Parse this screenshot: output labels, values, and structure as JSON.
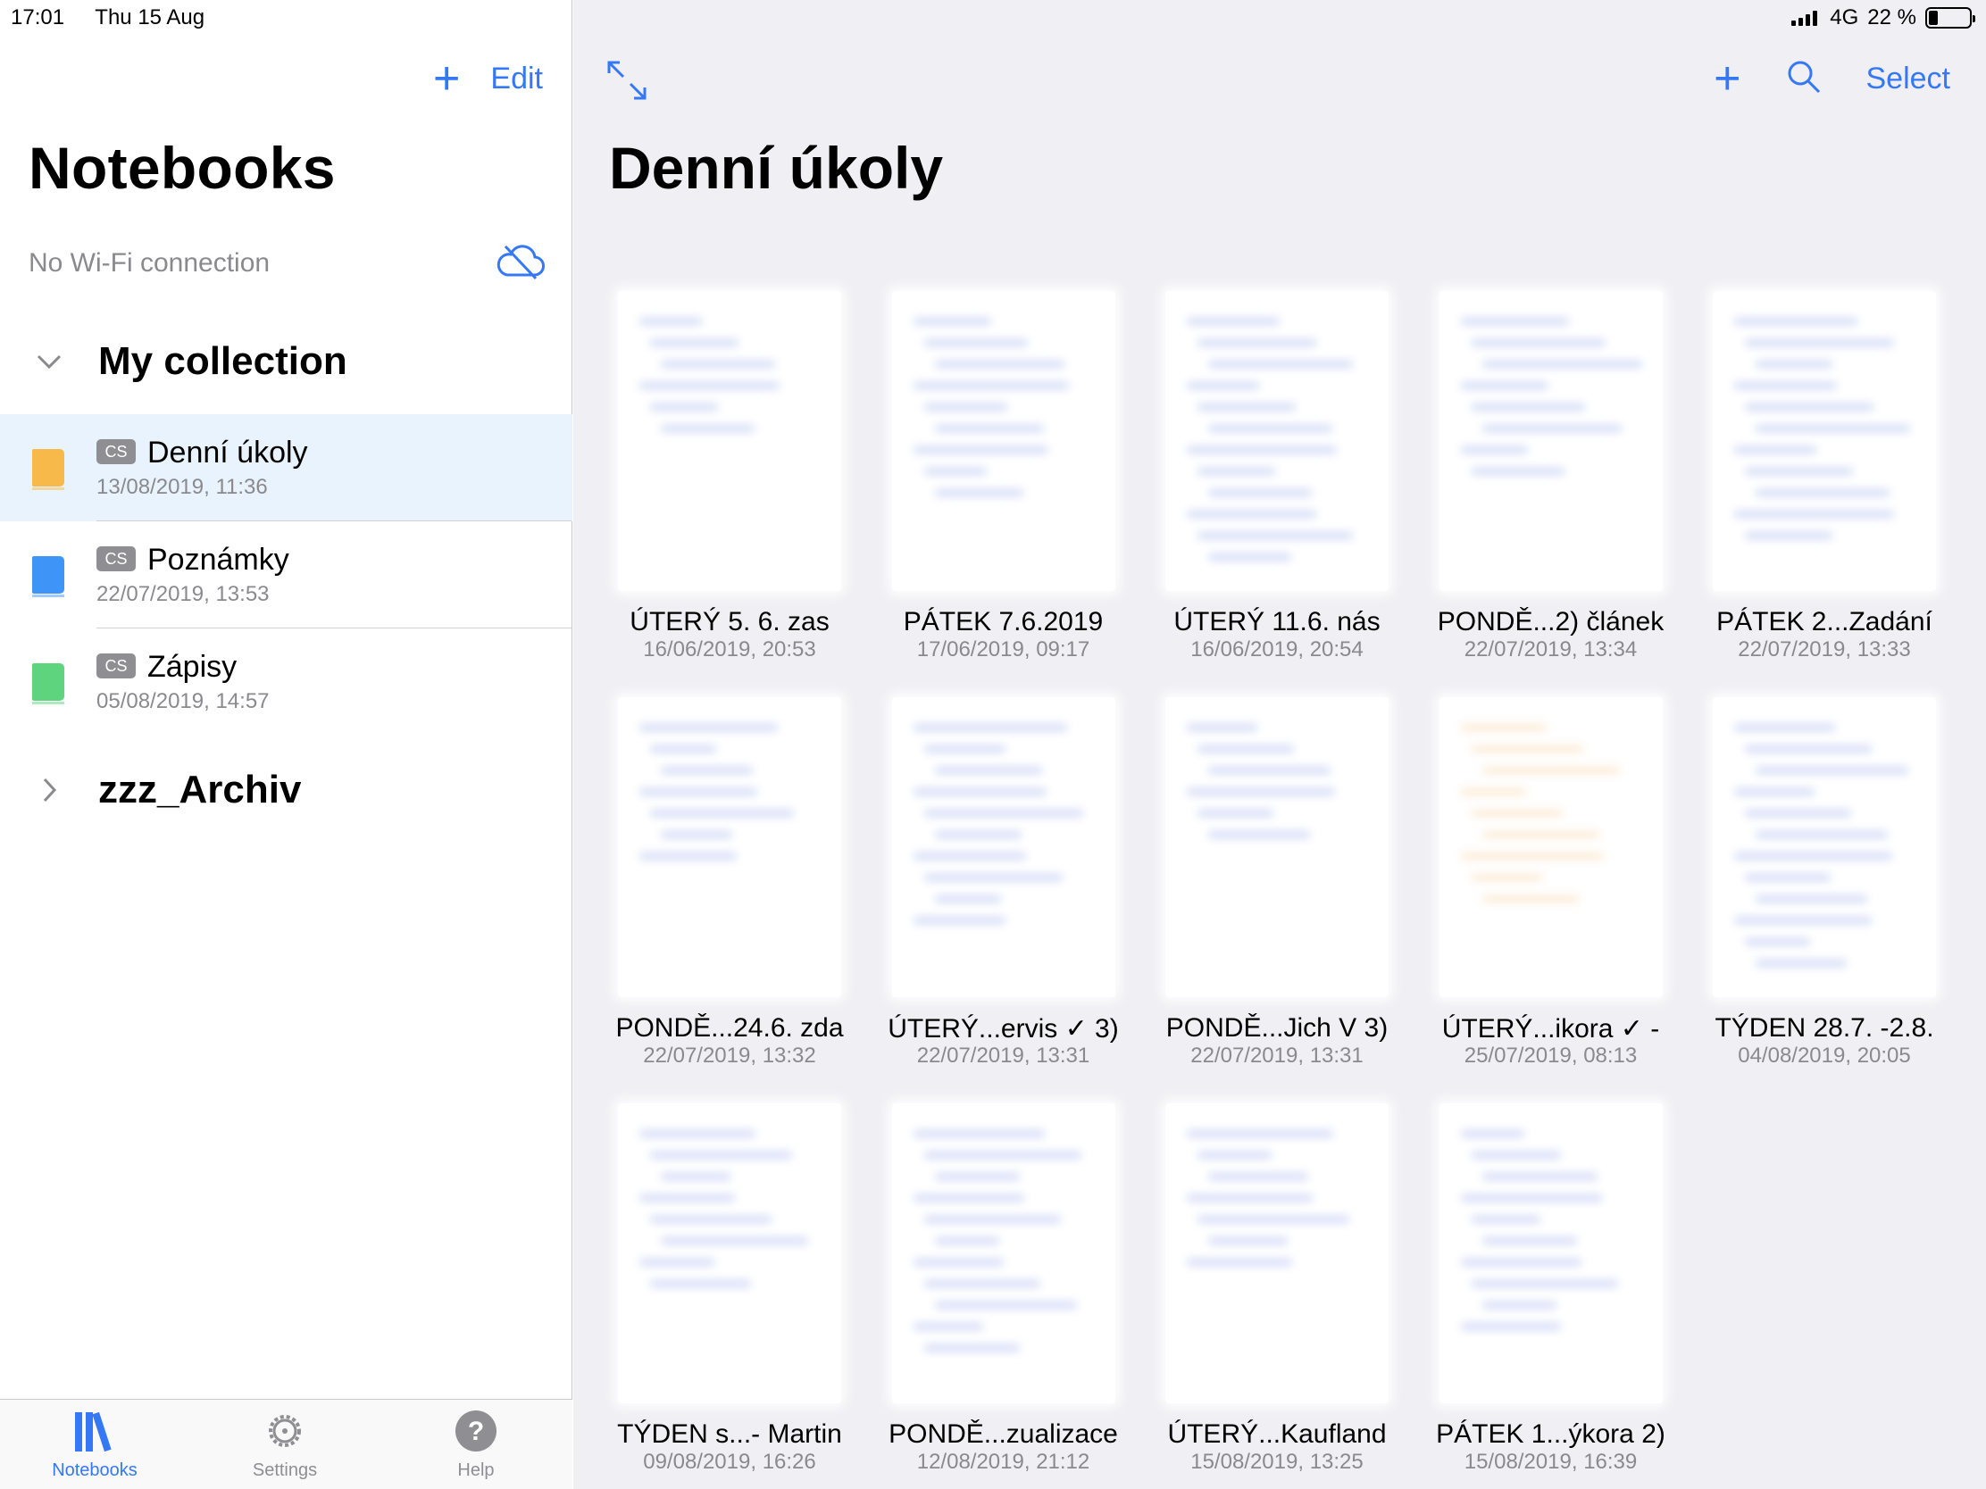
{
  "status_bar": {
    "time": "17:01",
    "date": "Thu 15 Aug",
    "network": "4G",
    "battery": "22 %",
    "battery_level": 0.22
  },
  "sidebar": {
    "add_label": "+",
    "edit_label": "Edit",
    "title": "Notebooks",
    "connection_status": "No Wi-Fi connection",
    "collections": [
      {
        "name": "My collection",
        "expanded": true,
        "notebooks": [
          {
            "tag": "CS",
            "name": "Denní úkoly",
            "date": "13/08/2019, 11:36",
            "color": "#f6b94a",
            "selected": true
          },
          {
            "tag": "CS",
            "name": "Poznámky",
            "date": "22/07/2019, 13:53",
            "color": "#3f95f7",
            "selected": false
          },
          {
            "tag": "CS",
            "name": "Zápisy",
            "date": "05/08/2019, 14:57",
            "color": "#5fd47f",
            "selected": false
          }
        ]
      },
      {
        "name": "zzz_Archiv",
        "expanded": false
      }
    ]
  },
  "tabbar": {
    "tabs": [
      {
        "label": "Notebooks",
        "icon": "notebooks-icon",
        "active": true
      },
      {
        "label": "Settings",
        "icon": "gear-icon",
        "active": false
      },
      {
        "label": "Help",
        "icon": "help-icon",
        "active": false
      }
    ]
  },
  "main": {
    "title": "Denní úkoly",
    "add_label": "+",
    "select_label": "Select",
    "pages": [
      {
        "title": "ÚTERÝ 5. 6. zas",
        "date": "16/06/2019, 20:53",
        "ink": "#3b5bd6"
      },
      {
        "title": "PÁTEK 7.6.2019",
        "date": "17/06/2019, 09:17",
        "ink": "#3b5bd6"
      },
      {
        "title": "ÚTERÝ 11.6. nás",
        "date": "16/06/2019, 20:54",
        "ink": "#3b5bd6"
      },
      {
        "title": "PONDĚ...2) článek",
        "date": "22/07/2019, 13:34",
        "ink": "#3b5bd6"
      },
      {
        "title": "PÁTEK 2...Zadání",
        "date": "22/07/2019, 13:33",
        "ink": "#3b5bd6"
      },
      {
        "title": "PONDĚ...24.6. zda",
        "date": "22/07/2019, 13:32",
        "ink": "#3b5bd6"
      },
      {
        "title": "ÚTERÝ...ervis ✓ 3)",
        "date": "22/07/2019, 13:31",
        "ink": "#3b5bd6"
      },
      {
        "title": "PONDĚ...Jich V 3)",
        "date": "22/07/2019, 13:31",
        "ink": "#3b5bd6"
      },
      {
        "title": "ÚTERÝ...ikora ✓ -",
        "date": "25/07/2019, 08:13",
        "ink": "#f0a040"
      },
      {
        "title": "TÝDEN 28.7. -2.8.",
        "date": "04/08/2019, 20:05",
        "ink": "#3b5bd6"
      },
      {
        "title": "TÝDEN s...- Martin",
        "date": "09/08/2019, 16:26",
        "ink": "#3b5bd6"
      },
      {
        "title": "PONDĚ...zualizace",
        "date": "12/08/2019, 21:12",
        "ink": "#3b5bd6"
      },
      {
        "title": "ÚTERÝ...Kaufland",
        "date": "15/08/2019, 13:25",
        "ink": "#3b5bd6"
      },
      {
        "title": "PÁTEK 1...ýkora 2)",
        "date": "15/08/2019, 16:39",
        "ink": "#3b5bd6"
      }
    ]
  },
  "colors": {
    "accent": "#3478f6",
    "selected_row": "#e9f3fd",
    "secondary_text": "#8a8a8e",
    "main_background": "#efeff4"
  }
}
